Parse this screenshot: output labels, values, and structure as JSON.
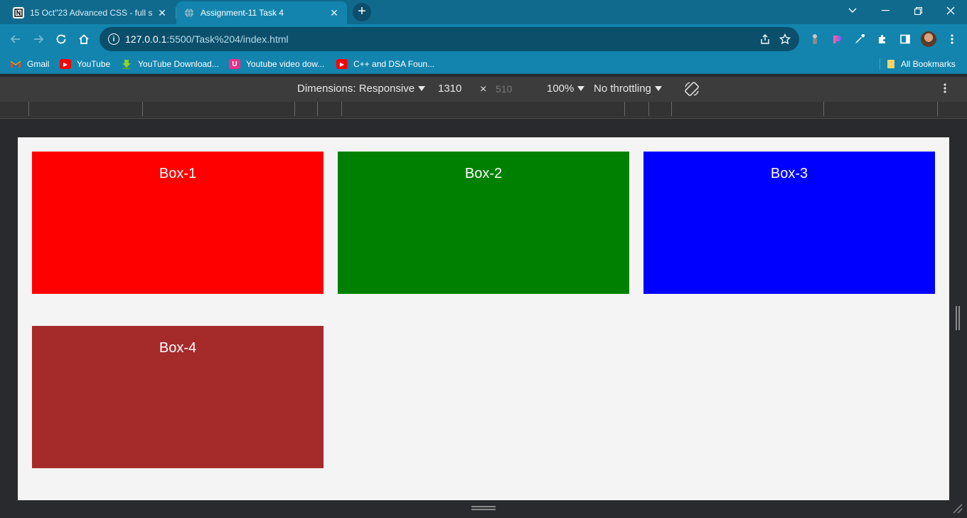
{
  "tabs": [
    {
      "title": "15 Oct\"23 Advanced CSS - full st",
      "favicon": "notion-icon",
      "state": "inactive"
    },
    {
      "title": "Assignment-11 Task 4",
      "favicon": "globe-icon",
      "state": "active"
    }
  ],
  "toolbar": {
    "url_host": "127.0.0.1",
    "url_path": ":5500/Task%204/index.html"
  },
  "bookmarks": [
    {
      "label": "Gmail",
      "icon": "gmail-icon"
    },
    {
      "label": "YouTube",
      "icon": "youtube-icon"
    },
    {
      "label": "YouTube Download...",
      "icon": "download-icon"
    },
    {
      "label": "Youtube video dow...",
      "icon": "u-icon"
    },
    {
      "label": "C++ and DSA Foun...",
      "icon": "youtube-icon"
    }
  ],
  "all_bookmarks": "All Bookmarks",
  "device_toolbar": {
    "dimensions_label": "Dimensions: Responsive",
    "width": "1310",
    "times": "×",
    "height": "510",
    "zoom": "100%",
    "throttling": "No throttling"
  },
  "boxes": [
    {
      "label": "Box-1",
      "color": "#ff0000"
    },
    {
      "label": "Box-2",
      "color": "#008000"
    },
    {
      "label": "Box-3",
      "color": "#0000ff"
    },
    {
      "label": "Box-4",
      "color": "#a52a2a"
    }
  ]
}
